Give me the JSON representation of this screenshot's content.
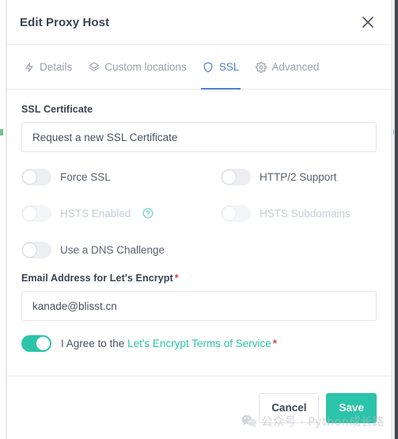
{
  "modal": {
    "title": "Edit Proxy Host",
    "close_icon": "close-icon"
  },
  "tabs": [
    {
      "label": "Details",
      "icon": "bolt-icon",
      "active": false
    },
    {
      "label": "Custom locations",
      "icon": "layers-icon",
      "active": false
    },
    {
      "label": "SSL",
      "icon": "shield-icon",
      "active": true
    },
    {
      "label": "Advanced",
      "icon": "gear-icon",
      "active": false
    }
  ],
  "ssl_section": {
    "certificate_label": "SSL Certificate",
    "certificate_value": "Request a new SSL Certificate",
    "toggles": [
      {
        "label": "Force SSL",
        "state": "off",
        "disabled": false,
        "help": false
      },
      {
        "label": "HTTP/2 Support",
        "state": "off",
        "disabled": false,
        "help": false
      },
      {
        "label": "HSTS Enabled",
        "state": "off",
        "disabled": true,
        "help": true
      },
      {
        "label": "HSTS Subdomains",
        "state": "off",
        "disabled": true,
        "help": false
      },
      {
        "label": "Use a DNS Challenge",
        "state": "off",
        "disabled": false,
        "help": false
      }
    ],
    "email_label": "Email Address for Let's Encrypt",
    "email_required_mark": "*",
    "email_value": "kanade@blisst.cn",
    "agree_prefix": "I Agree to the",
    "agree_link": "Let's Encrypt Terms of Service",
    "agree_required_mark": "*",
    "agree_state": "on"
  },
  "footer": {
    "cancel_label": "Cancel",
    "save_label": "Save"
  },
  "watermark": {
    "icon": "wechat-icon",
    "text": "公众号 · Python成长路"
  },
  "colors": {
    "accent_teal": "#2bc4a8",
    "tab_active_blue": "#4d7fd1",
    "required_red": "#e23b3b",
    "label_dark": "#3b4250",
    "muted_text": "#9aa1ae"
  }
}
